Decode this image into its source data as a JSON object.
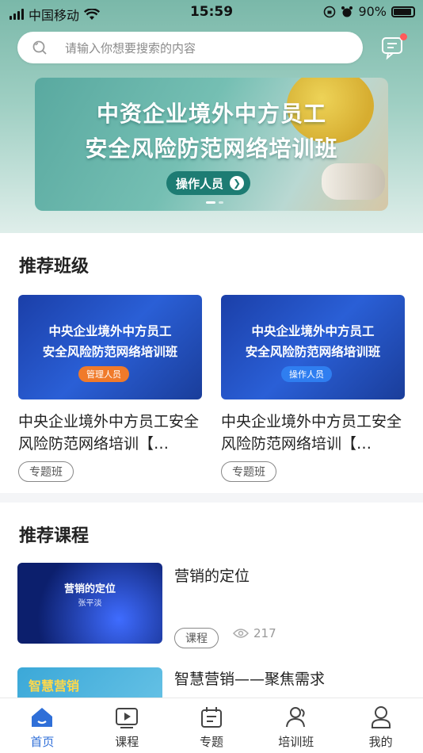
{
  "status_bar": {
    "carrier": "中国移动",
    "time": "15:59",
    "battery": "90%"
  },
  "search": {
    "placeholder": "请输入你想要搜索的内容"
  },
  "banner": {
    "line1": "中资企业境外中方员工",
    "line2": "安全风险防范网络培训班",
    "button_label": "操作人员"
  },
  "recommended_classes": {
    "title": "推荐班级",
    "items": [
      {
        "img_line1": "中央企业境外中方员工",
        "img_line2": "安全风险防范网络培训班",
        "img_button": "管理人员",
        "img_button_color": "#f07a2a",
        "name": "中央企业境外中方员工安全风险防范网络培训【…",
        "tag": "专题班"
      },
      {
        "img_line1": "中央企业境外中方员工",
        "img_line2": "安全风险防范网络培训班",
        "img_button": "操作人员",
        "img_button_color": "#2f7ef0",
        "name": "中央企业境外中方员工安全风险防范网络培训【…",
        "tag": "专题班"
      }
    ]
  },
  "recommended_courses": {
    "title": "推荐课程",
    "items": [
      {
        "thumb_title": "营销的定位",
        "thumb_sub": "张平淡",
        "title": "营销的定位",
        "tag": "课程",
        "views": "217"
      },
      {
        "thumb_title": "智慧营销",
        "title": "智慧营销——聚焦需求"
      }
    ]
  },
  "tabbar": {
    "items": [
      {
        "label": "首页",
        "icon": "home-icon",
        "active": true
      },
      {
        "label": "课程",
        "icon": "video-icon"
      },
      {
        "label": "专题",
        "icon": "topic-icon"
      },
      {
        "label": "培训班",
        "icon": "group-icon"
      },
      {
        "label": "我的",
        "icon": "user-icon"
      }
    ]
  },
  "colors": {
    "accent": "#2f6fd8",
    "banner_teal": "#6fb5a8",
    "class_blue": "#1f4bb5"
  }
}
